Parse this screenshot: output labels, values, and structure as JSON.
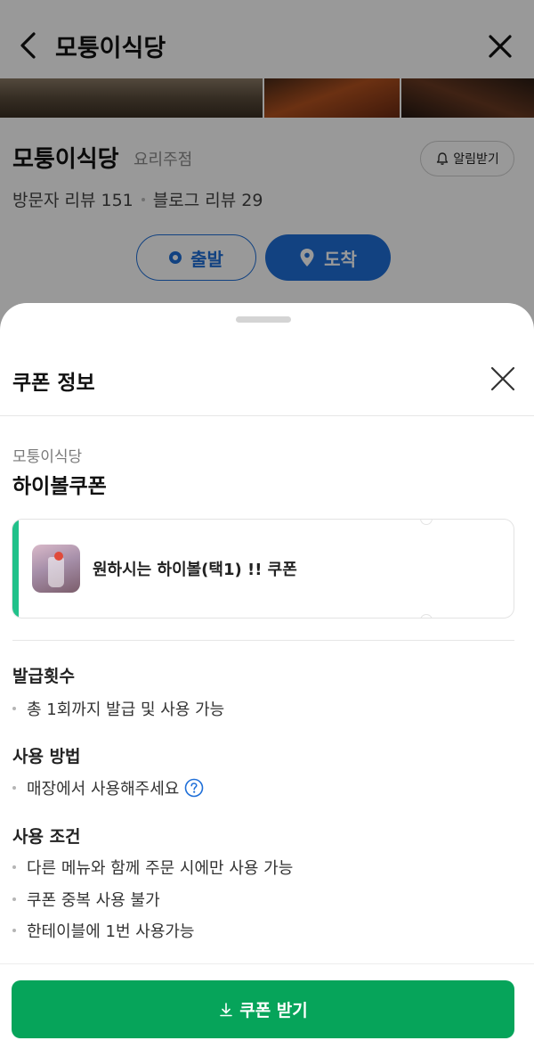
{
  "header": {
    "back_icon": "chevron-left-icon",
    "title": "모퉁이식당",
    "close_icon": "close-icon"
  },
  "place": {
    "name": "모퉁이식당",
    "category": "요리주점",
    "alarm_label": "알림받기",
    "visitor_reviews": "방문자 리뷰 151",
    "blog_reviews": "블로그 리뷰 29",
    "depart_label": "출발",
    "arrive_label": "도착"
  },
  "sheet": {
    "title": "쿠폰 정보",
    "store_name": "모퉁이식당",
    "coupon_name": "하이볼쿠폰",
    "coupon_desc": "원하시는 하이볼(택1) !! 쿠폰",
    "sections": [
      {
        "heading": "발급횟수",
        "items": [
          "총 1회까지 발급 및 사용 가능"
        ]
      },
      {
        "heading": "사용 방법",
        "items": [
          "매장에서 사용해주세요"
        ]
      },
      {
        "heading": "사용 조건",
        "items": [
          "다른 메뉴와 함께 주문 시에만 사용 가능",
          "쿠폰 중복 사용 불가",
          "한테이블에 1번 사용가능"
        ]
      }
    ],
    "button_label": "쿠폰 받기"
  },
  "colors": {
    "brand_green": "#06a45a",
    "accent_mint": "#21c18a",
    "route_blue": "#1f6fd8"
  }
}
